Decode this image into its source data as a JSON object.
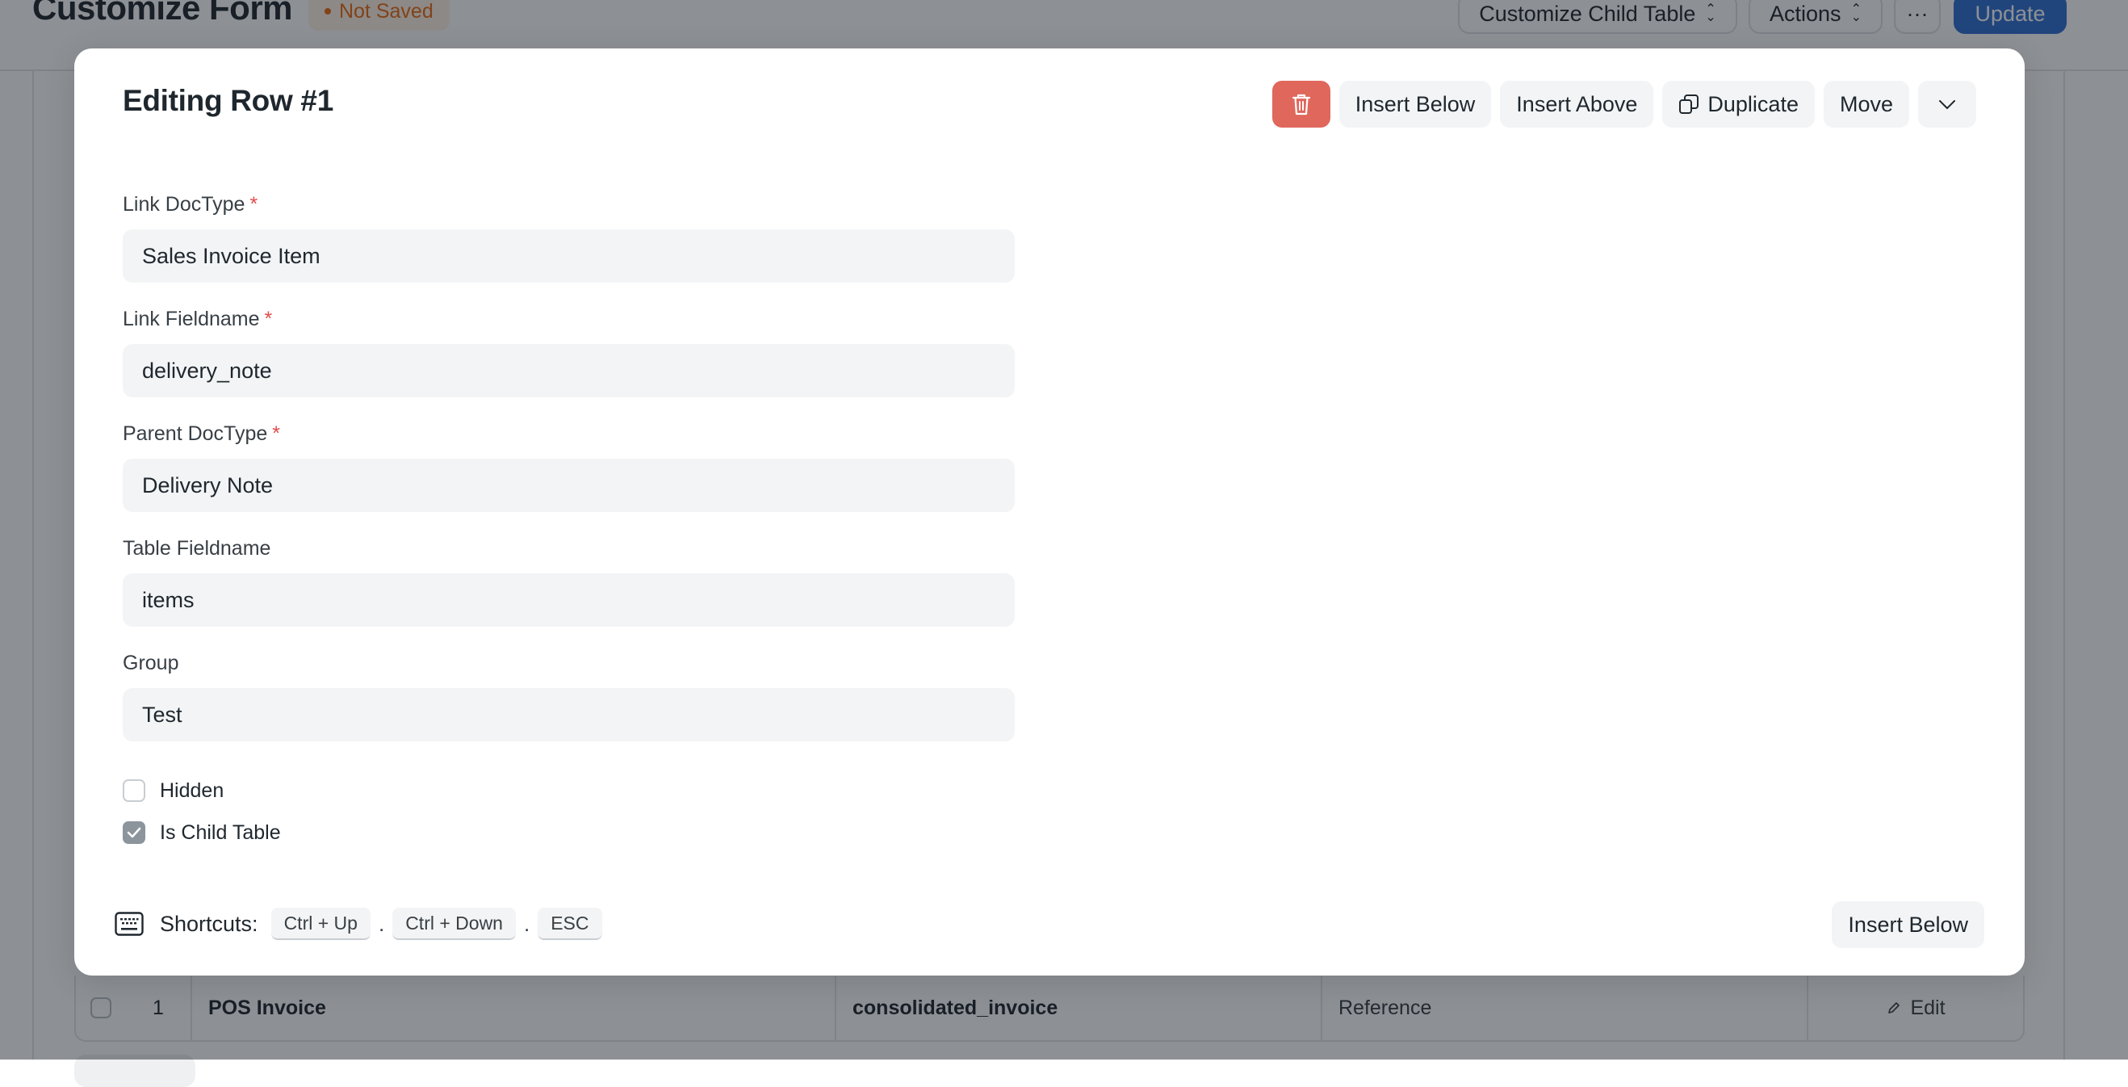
{
  "page": {
    "title": "Customize Form",
    "status_badge": "Not Saved",
    "header_buttons": {
      "customize_child_table": "Customize Child Table",
      "actions": "Actions",
      "more": "···",
      "update": "Update"
    }
  },
  "grid": {
    "row": {
      "index": "1",
      "link_doctype": "POS Invoice",
      "link_fieldname": "consolidated_invoice",
      "group": "Reference",
      "edit_label": "Edit"
    }
  },
  "modal": {
    "title": "Editing Row #1",
    "toolbar": {
      "delete_icon": "trash-icon",
      "insert_below": "Insert Below",
      "insert_above": "Insert Above",
      "duplicate": "Duplicate",
      "move": "Move"
    },
    "fields": [
      {
        "label": "Link DocType",
        "required": true,
        "value": "Sales Invoice Item"
      },
      {
        "label": "Link Fieldname",
        "required": true,
        "value": "delivery_note"
      },
      {
        "label": "Parent DocType",
        "required": true,
        "value": "Delivery Note"
      },
      {
        "label": "Table Fieldname",
        "required": false,
        "value": "items"
      },
      {
        "label": "Group",
        "required": false,
        "value": "Test"
      }
    ],
    "checkboxes": [
      {
        "label": "Hidden",
        "checked": false
      },
      {
        "label": "Is Child Table",
        "checked": true
      }
    ],
    "footer": {
      "shortcuts_label": "Shortcuts:",
      "keys": [
        "Ctrl + Up",
        "Ctrl + Down",
        "ESC"
      ],
      "separator": ".",
      "insert_below": "Insert Below"
    }
  },
  "colors": {
    "danger": "#e0675c",
    "primary": "#2f6fd3",
    "warning_text": "#e86c13",
    "required_star": "#e24c4c"
  }
}
